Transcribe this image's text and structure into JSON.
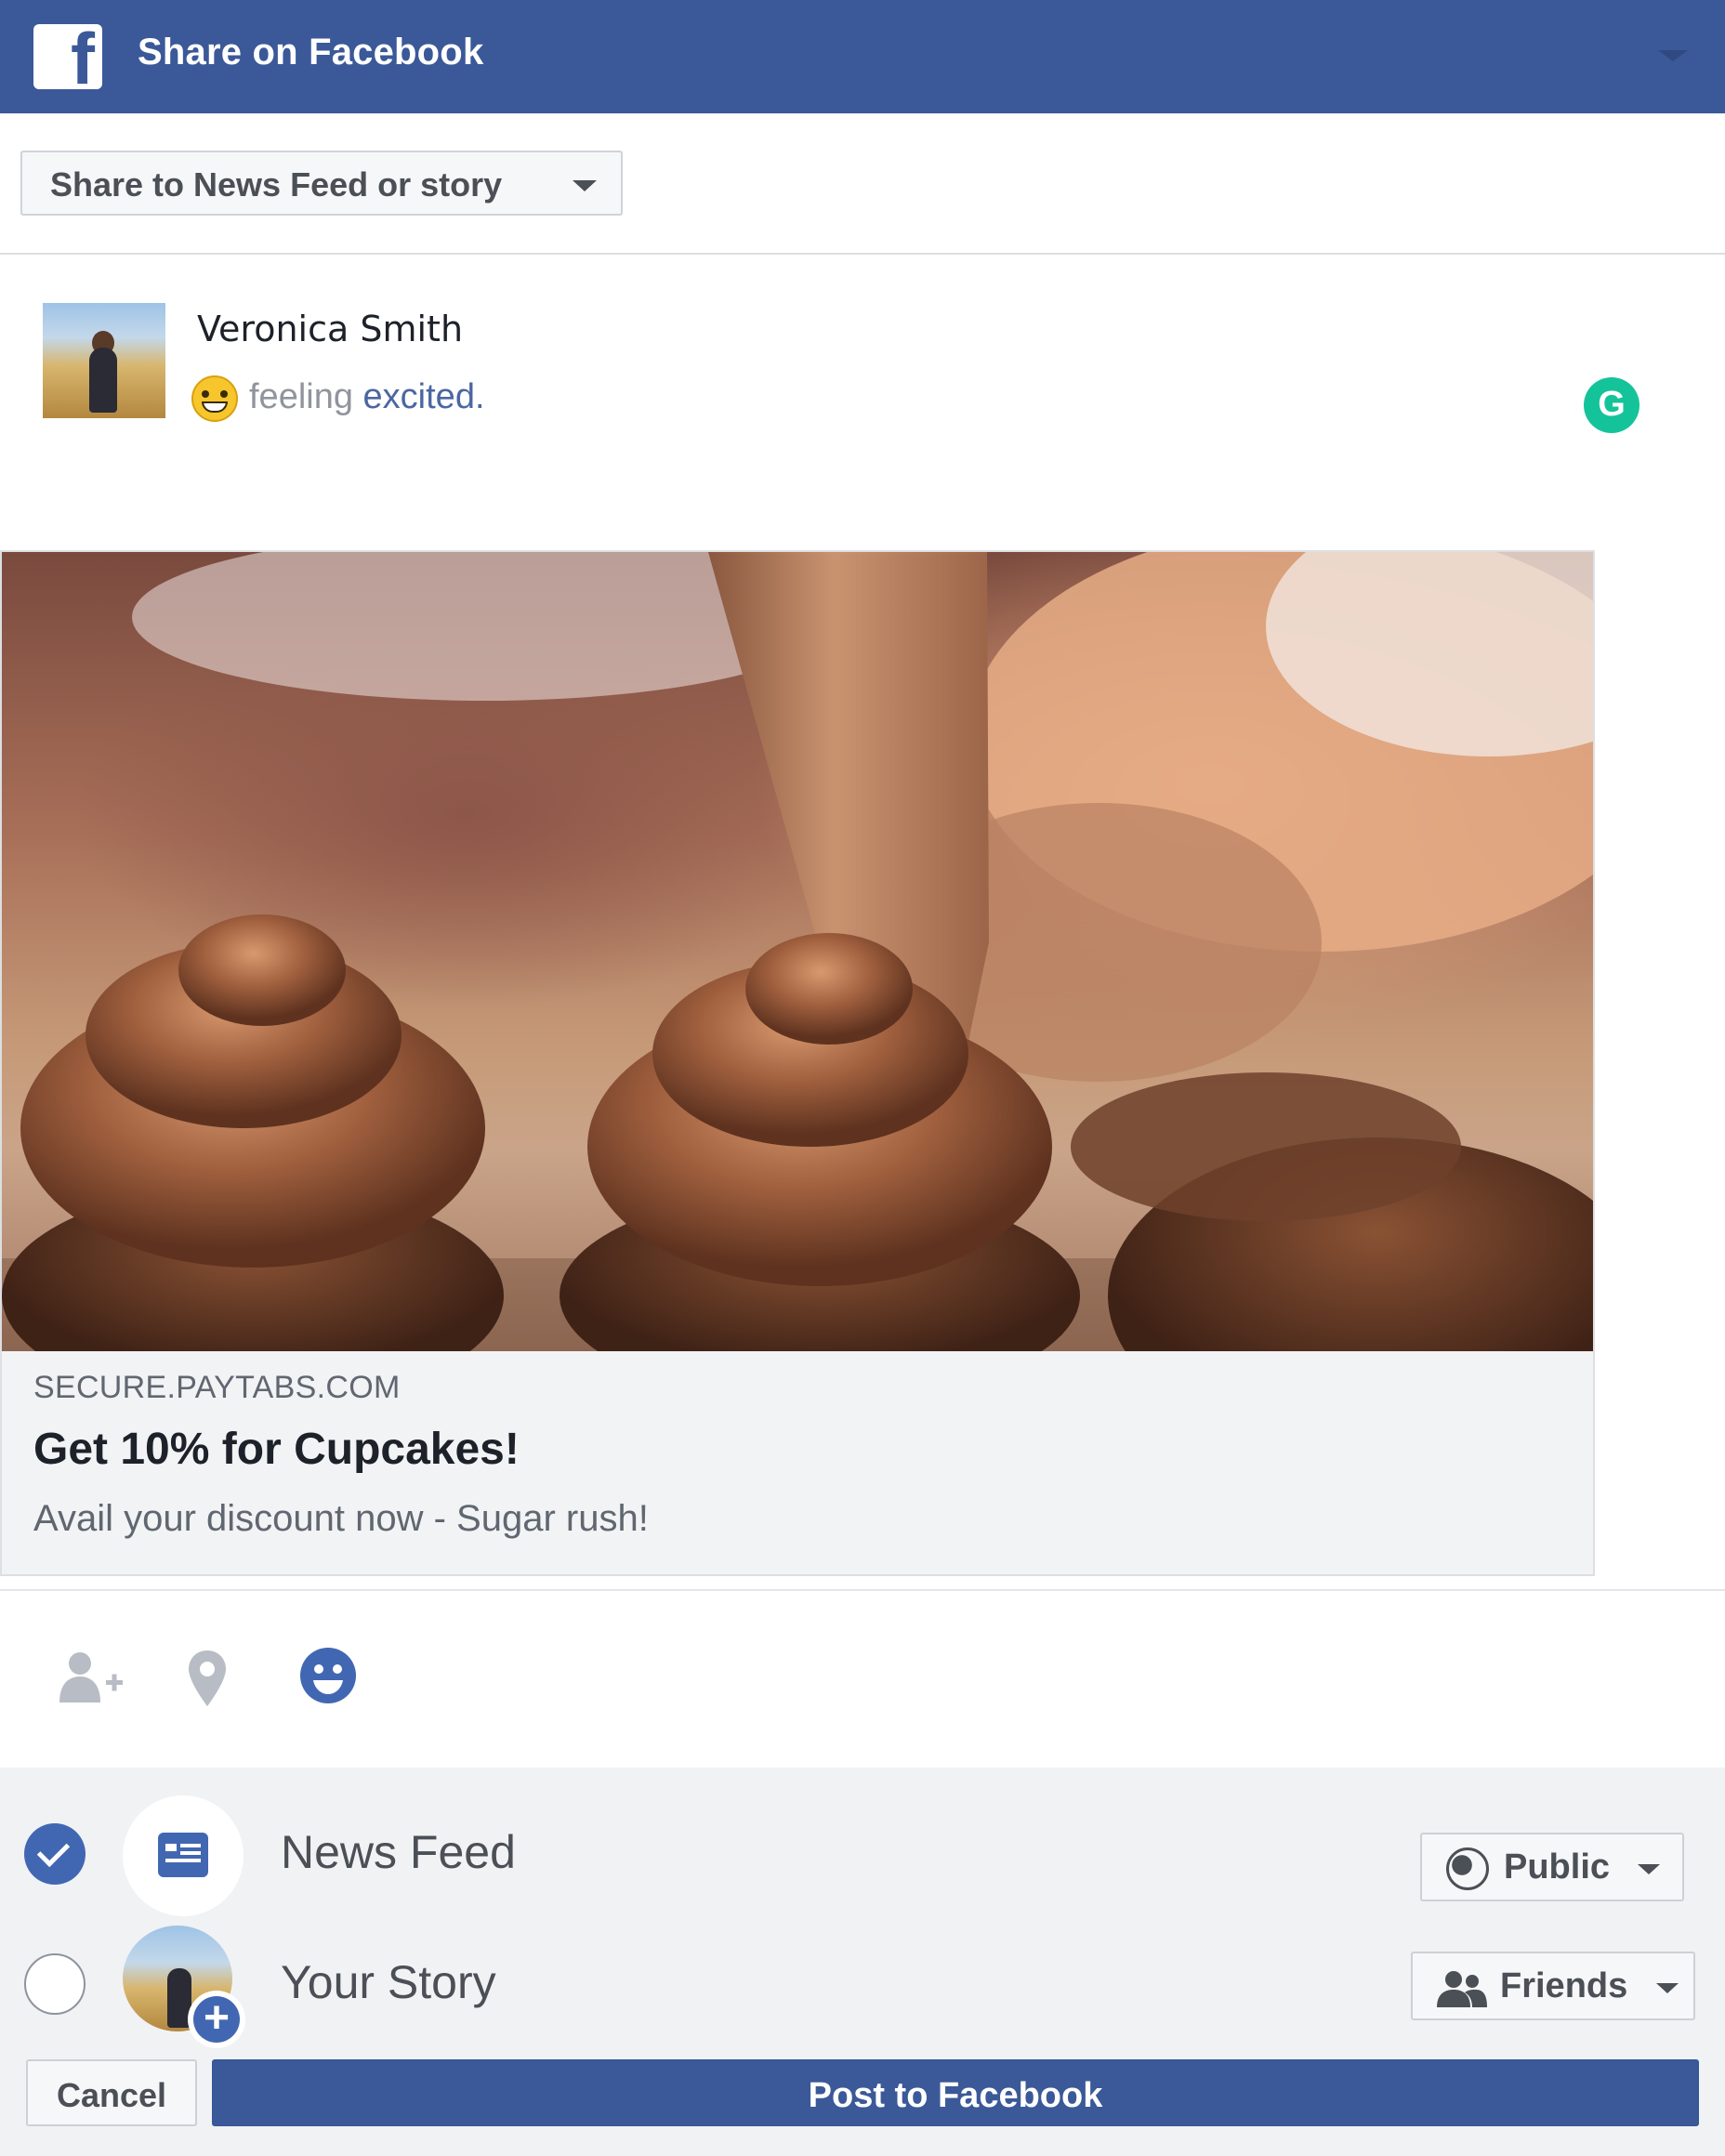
{
  "header": {
    "logo_letter": "f",
    "title": "Share on Facebook",
    "brand_color": "#3b5998"
  },
  "share_target": {
    "label": "Share to News Feed or story"
  },
  "post": {
    "user_name": "Veronica Smith",
    "feeling_prefix": "feeling",
    "feeling_value": "excited.",
    "grammarly_letter": "G"
  },
  "link_preview": {
    "domain": "SECURE.PAYTABS.COM",
    "title": "Get 10% for Cupcakes!",
    "description": "Avail your discount now - Sugar rush!"
  },
  "actions": {
    "icons": [
      "tag-people-icon",
      "location-pin-icon",
      "feeling-face-icon"
    ]
  },
  "destinations": {
    "news_feed": {
      "label": "News Feed",
      "checked": true,
      "audience": "Public"
    },
    "your_story": {
      "label": "Your Story",
      "checked": false,
      "audience": "Friends"
    }
  },
  "buttons": {
    "cancel": "Cancel",
    "post": "Post to Facebook"
  }
}
